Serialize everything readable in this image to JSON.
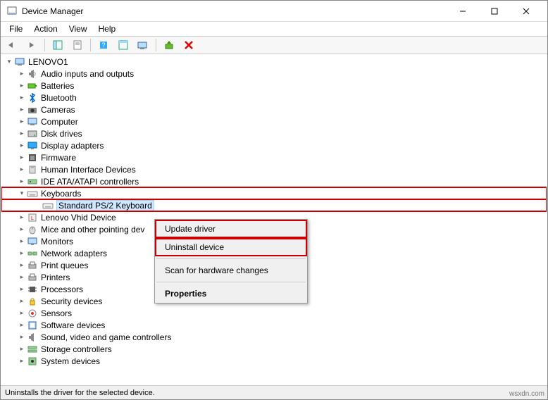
{
  "window": {
    "title": "Device Manager"
  },
  "menu": {
    "file": "File",
    "action": "Action",
    "view": "View",
    "help": "Help"
  },
  "root": {
    "name": "LENOVO1"
  },
  "devices": [
    {
      "name": "Audio inputs and outputs",
      "icon": "speaker"
    },
    {
      "name": "Batteries",
      "icon": "battery"
    },
    {
      "name": "Bluetooth",
      "icon": "bluetooth"
    },
    {
      "name": "Cameras",
      "icon": "camera"
    },
    {
      "name": "Computer",
      "icon": "computer"
    },
    {
      "name": "Disk drives",
      "icon": "disk"
    },
    {
      "name": "Display adapters",
      "icon": "display"
    },
    {
      "name": "Firmware",
      "icon": "firmware"
    },
    {
      "name": "Human Interface Devices",
      "icon": "hid"
    },
    {
      "name": "IDE ATA/ATAPI controllers",
      "icon": "ide"
    },
    {
      "name": "Keyboards",
      "icon": "keyboard",
      "expanded": true,
      "highlighted": true,
      "children": [
        {
          "name": "Standard PS/2 Keyboard",
          "icon": "keyboard",
          "selected": true,
          "highlighted": true
        }
      ]
    },
    {
      "name": "Lenovo Vhid Device",
      "icon": "lenovo"
    },
    {
      "name": "Mice and other pointing dev",
      "icon": "mouse"
    },
    {
      "name": "Monitors",
      "icon": "monitor"
    },
    {
      "name": "Network adapters",
      "icon": "network"
    },
    {
      "name": "Print queues",
      "icon": "printer"
    },
    {
      "name": "Printers",
      "icon": "printer"
    },
    {
      "name": "Processors",
      "icon": "processor"
    },
    {
      "name": "Security devices",
      "icon": "security"
    },
    {
      "name": "Sensors",
      "icon": "sensor"
    },
    {
      "name": "Software devices",
      "icon": "software"
    },
    {
      "name": "Sound, video and game controllers",
      "icon": "sound"
    },
    {
      "name": "Storage controllers",
      "icon": "storage"
    },
    {
      "name": "System devices",
      "icon": "system"
    }
  ],
  "context_menu": {
    "update": "Update driver",
    "uninstall": "Uninstall device",
    "scan": "Scan for hardware changes",
    "properties": "Properties"
  },
  "status": "Uninstalls the driver for the selected device.",
  "watermark": "wsxdn.com"
}
